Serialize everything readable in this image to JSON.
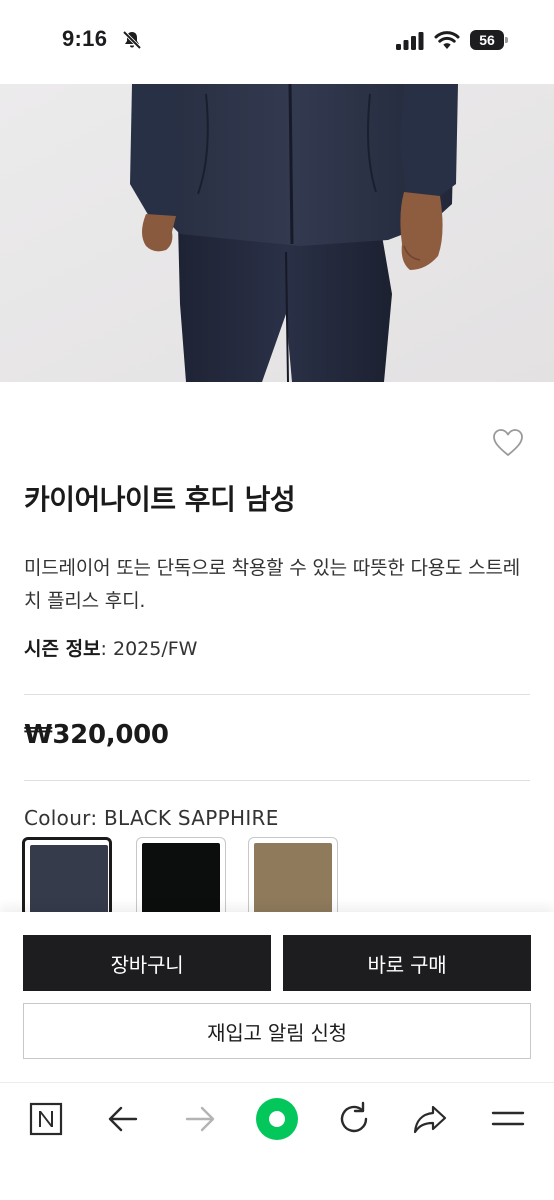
{
  "status_bar": {
    "time": "9:16",
    "battery": "56",
    "icons": [
      "bell-off-icon",
      "cellular-signal-icon",
      "wifi-icon",
      "battery-icon"
    ]
  },
  "product": {
    "image_icon": "product-photo",
    "title": "카이어나이트 후디 남성",
    "description": "미드레이어 또는 단독으로 착용할 수 있는 따뜻한 다용도 스트레치 플리스 후디.",
    "season_label": "시즌 정보",
    "season_value": ": 2025/FW",
    "price": "₩320,000",
    "colour_label": "Colour",
    "colour_value": ": BLACK SAPPHIRE",
    "swatches": [
      {
        "name": "BLACK SAPPHIRE",
        "color": "#363b4c",
        "selected": true
      },
      {
        "name": "BLACK",
        "color": "#0c0d0d",
        "selected": false
      },
      {
        "name": "TAN",
        "color": "#8f7a5c",
        "selected": false
      }
    ]
  },
  "actions": {
    "cart": "장바구니",
    "buy_now": "바로 구매",
    "restock_alert": "재입고 알림 신청"
  },
  "browser_toolbar": {
    "icons": [
      "naver-n-icon",
      "back-arrow-icon",
      "forward-arrow-icon",
      "green-dot-icon",
      "refresh-icon",
      "share-icon",
      "menu-icon"
    ],
    "accent": "#03c75a"
  }
}
